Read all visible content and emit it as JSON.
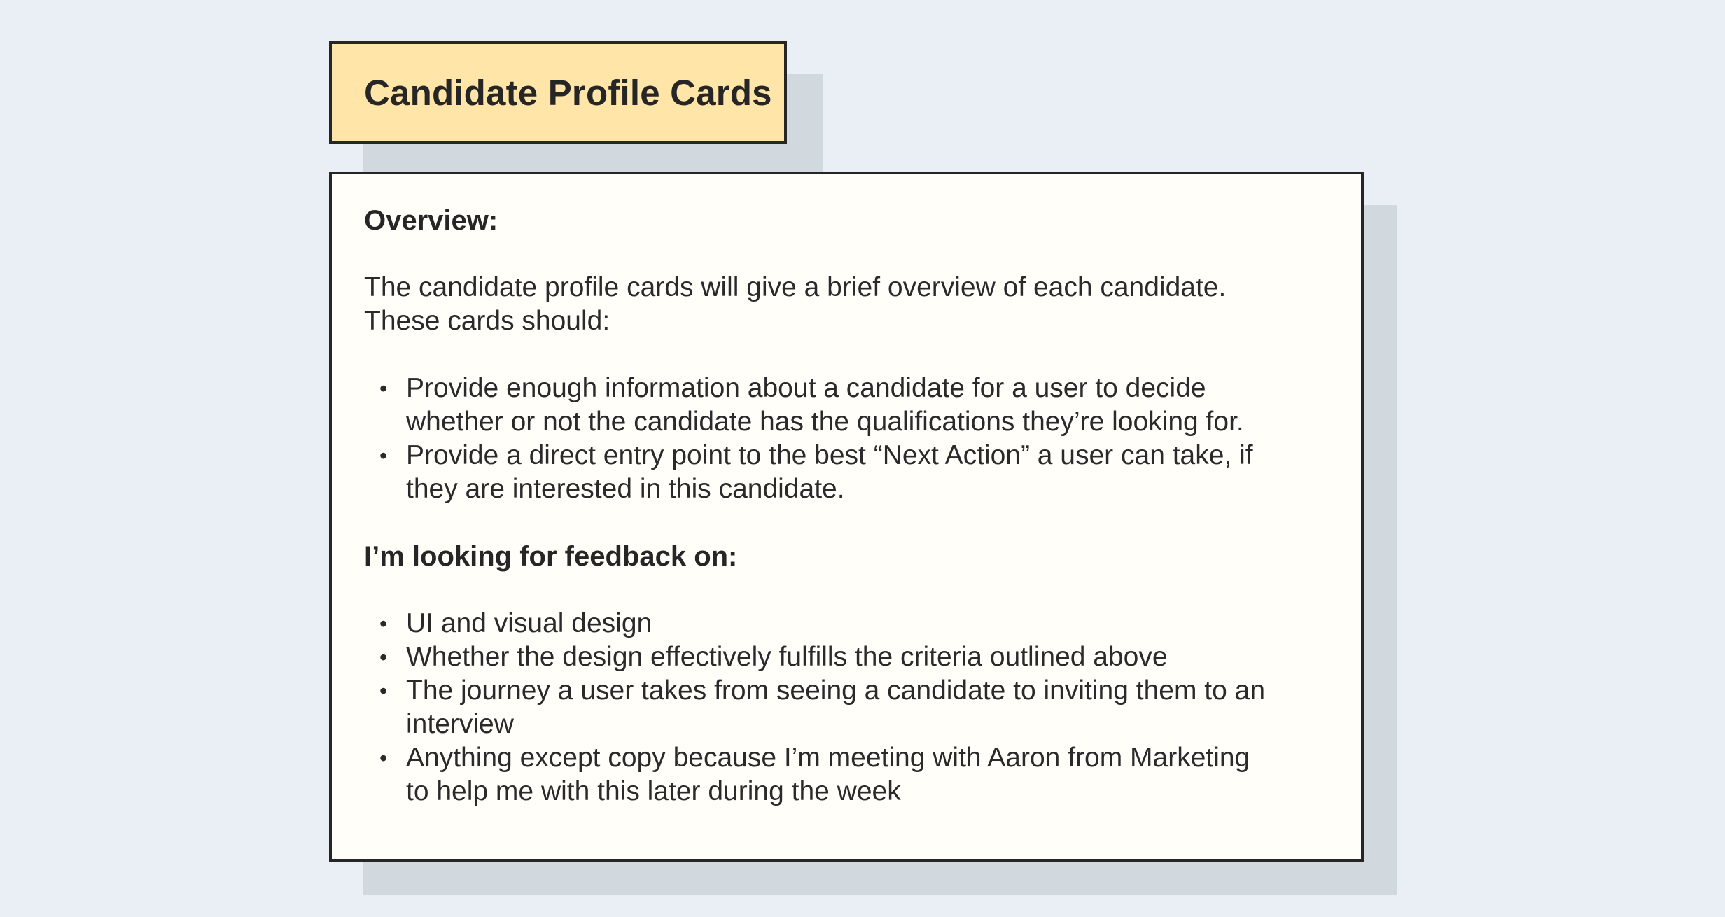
{
  "title": "Candidate Profile Cards",
  "overview": {
    "heading": "Overview:",
    "intro_line1": "The candidate profile cards will give a brief overview of each candidate.",
    "intro_line2": "These cards should:",
    "bullets": [
      {
        "line1": "Provide enough information about a candidate for a user to decide",
        "line2": "whether or not the candidate has the qualifications they’re looking for."
      },
      {
        "line1": "Provide a direct entry point to the best “Next Action” a user can take, if",
        "line2": "they are interested in this candidate."
      }
    ]
  },
  "feedback": {
    "heading": "I’m looking for feedback on:",
    "bullets": [
      {
        "line1": "UI and visual design"
      },
      {
        "line1": "Whether the design effectively fulfills the criteria outlined above"
      },
      {
        "line1": "The journey a user takes from seeing a candidate to inviting them to an",
        "line2": "interview"
      },
      {
        "line1": "Anything except copy because I’m meeting with Aaron from Marketing",
        "line2": "to help me with this later during the week"
      }
    ]
  },
  "bullet_glyph": "•",
  "colors": {
    "background": "#e9eff5",
    "title_fill": "#ffe6a8",
    "card_fill": "#fffef9",
    "shadow": "#d1d8de",
    "border": "#262626"
  }
}
